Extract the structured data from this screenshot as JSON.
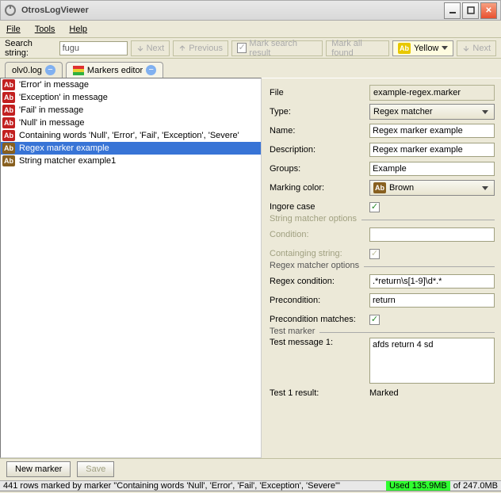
{
  "window": {
    "title": "OtrosLogViewer"
  },
  "menu": {
    "file": "File",
    "tools": "Tools",
    "help": "Help"
  },
  "search": {
    "label": "Search string:",
    "value": "fugu",
    "next": "Next",
    "previous": "Previous",
    "mark_result": "Mark search result",
    "mark_all": "Mark all found",
    "color": "Yellow"
  },
  "tabs": {
    "olv": "olv0.log",
    "markers": "Markers editor"
  },
  "markers_list": [
    {
      "badge": "red",
      "label": "'Error' in message"
    },
    {
      "badge": "red",
      "label": "'Exception' in message"
    },
    {
      "badge": "red",
      "label": "'Fail' in message"
    },
    {
      "badge": "red",
      "label": "'Null' in message"
    },
    {
      "badge": "red",
      "label": "Containing words 'Null', 'Error', 'Fail', 'Exception', 'Severe'"
    },
    {
      "badge": "brown",
      "label": "Regex marker example"
    },
    {
      "badge": "brown",
      "label": "String matcher example1"
    }
  ],
  "selected_index": 5,
  "form": {
    "file_lbl": "File",
    "file_val": "example-regex.marker",
    "type_lbl": "Type:",
    "type_val": "Regex matcher",
    "name_lbl": "Name:",
    "name_val": "Regex marker example",
    "desc_lbl": "Description:",
    "desc_val": "Regex marker example",
    "groups_lbl": "Groups:",
    "groups_val": "Example",
    "color_lbl": "Marking color:",
    "color_val": "Brown",
    "ignore_lbl": "Ingore case",
    "string_opts": "String matcher options",
    "cond_lbl": "Condition:",
    "contain_lbl": "Containging string:",
    "regex_opts": "Regex matcher options",
    "regex_cond_lbl": "Regex condition:",
    "regex_cond_val": ".*return\\s[1-9]\\d*.*",
    "precond_lbl": "Precondition:",
    "precond_val": "return",
    "precond_match_lbl": "Precondition matches:",
    "test_marker": "Test marker",
    "test_msg_lbl": "Test message 1:",
    "test_msg_val": "afds return 4 sd",
    "test_res_lbl": "Test 1 result:",
    "test_res_val": "Marked"
  },
  "buttons": {
    "new_marker": "New marker",
    "save": "Save"
  },
  "status": {
    "left": "441 rows marked by marker \"Containing words 'Null', 'Error', 'Fail', 'Exception', 'Severe'\"",
    "used": "Used 135.9MB",
    "total": " of 247.0MB"
  }
}
